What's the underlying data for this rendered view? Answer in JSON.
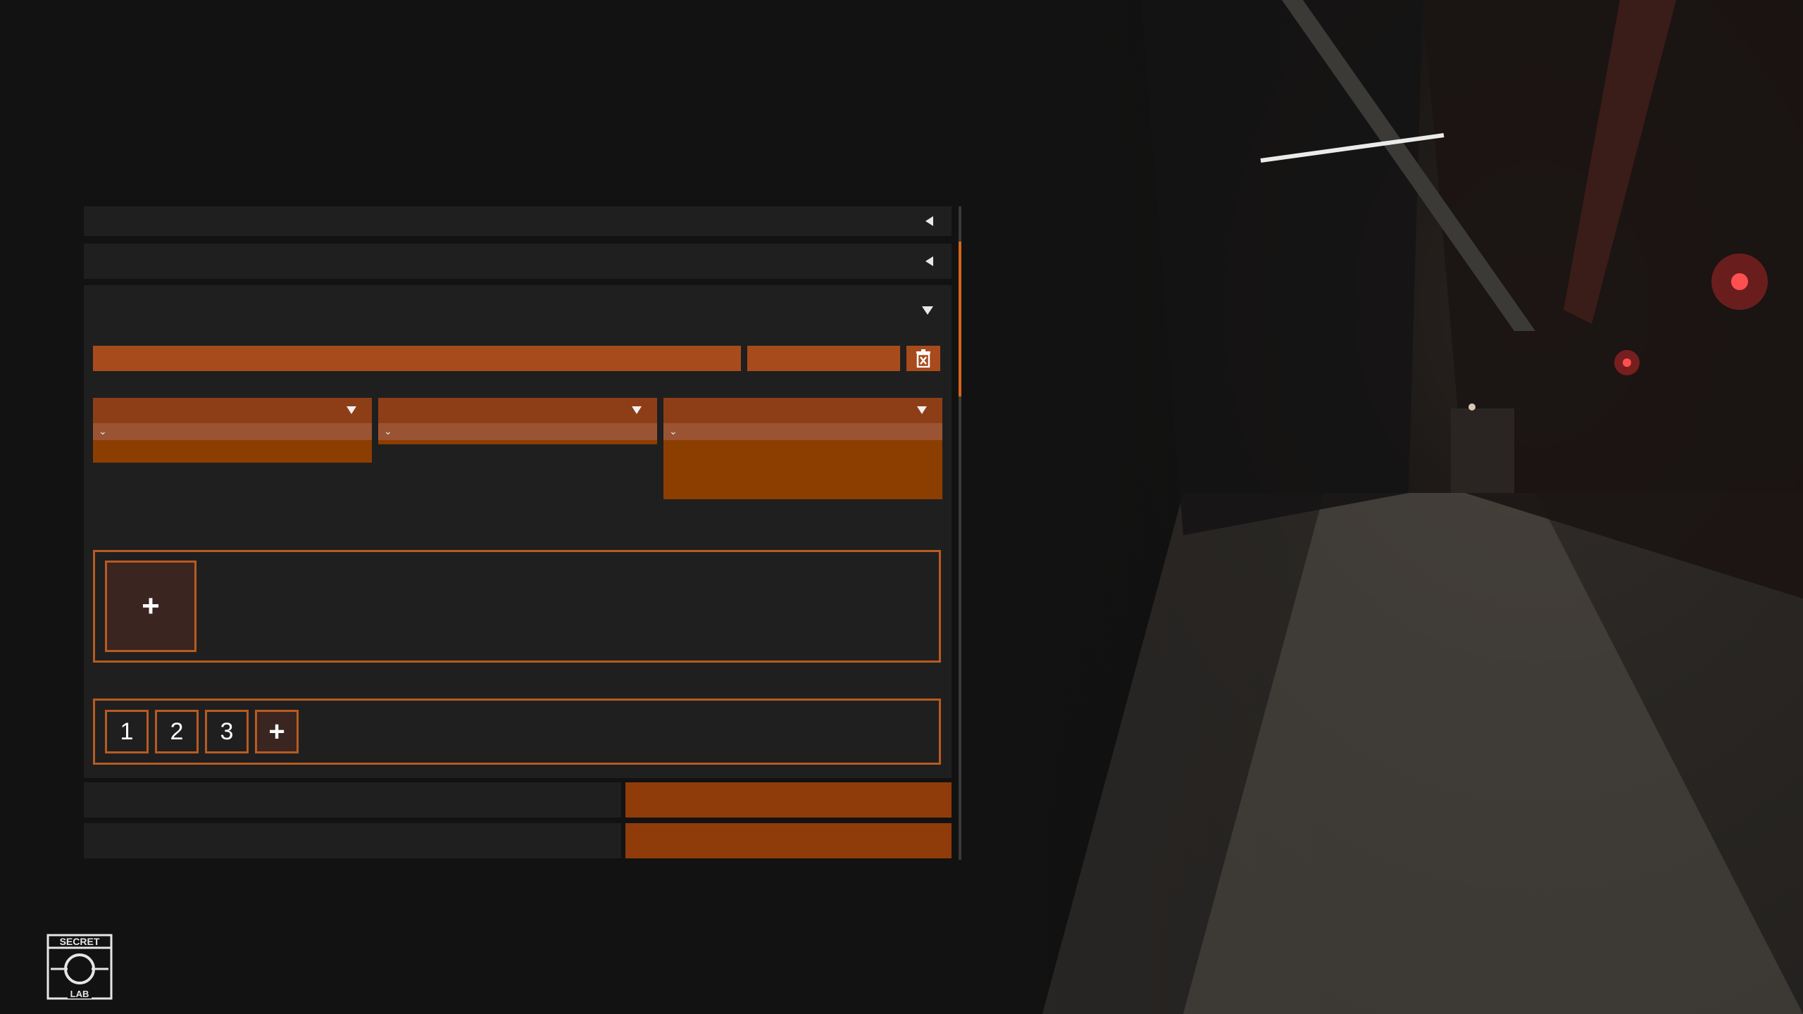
{
  "panel": {
    "collapsed_sections": [
      {
        "state": "collapsed",
        "icon": "arrow-left-icon"
      },
      {
        "state": "collapsed",
        "icon": "arrow-left-icon"
      }
    ],
    "expanded_section": {
      "state": "expanded",
      "icon": "arrow-down-icon"
    },
    "delete_button": {
      "icon": "trash-x-icon"
    },
    "dropdowns": [
      {
        "icon": "triangle-down-icon",
        "option_icon": "chevron-down-icon"
      },
      {
        "icon": "triangle-down-icon",
        "option_icon": "chevron-down-icon"
      },
      {
        "icon": "triangle-down-icon",
        "option_icon": "chevron-down-icon"
      }
    ],
    "add_tile": {
      "label": "+"
    },
    "numbered_tiles": [
      "1",
      "2",
      "3"
    ],
    "numbered_add": "+"
  },
  "colors": {
    "accent": "#d3661a",
    "field": "#a84b1c",
    "dropdown_head": "#8e3e16",
    "dropdown_list": "#8c3e00",
    "row": "#1f1f1f",
    "background": "#121212"
  },
  "logo": {
    "top_text": "SECRET",
    "bottom_text": "LAB"
  }
}
